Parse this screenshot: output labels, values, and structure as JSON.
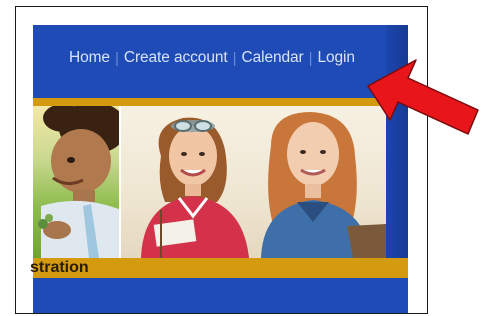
{
  "nav": {
    "items": [
      {
        "label": "Home"
      },
      {
        "label": "Create account"
      },
      {
        "label": "Calendar"
      },
      {
        "label": "Login"
      }
    ],
    "separator": "|"
  },
  "banner": {
    "caption": "stration",
    "photos": [
      "child-photo",
      "students-photo"
    ]
  },
  "colors": {
    "page_blue": "#1e4bb5",
    "gold_band": "#d49a10",
    "nav_text": "#d8e3f8",
    "annotation_arrow": "#e8161b"
  },
  "annotation": {
    "icon": "red-arrow-icon",
    "points_to": "Login"
  }
}
